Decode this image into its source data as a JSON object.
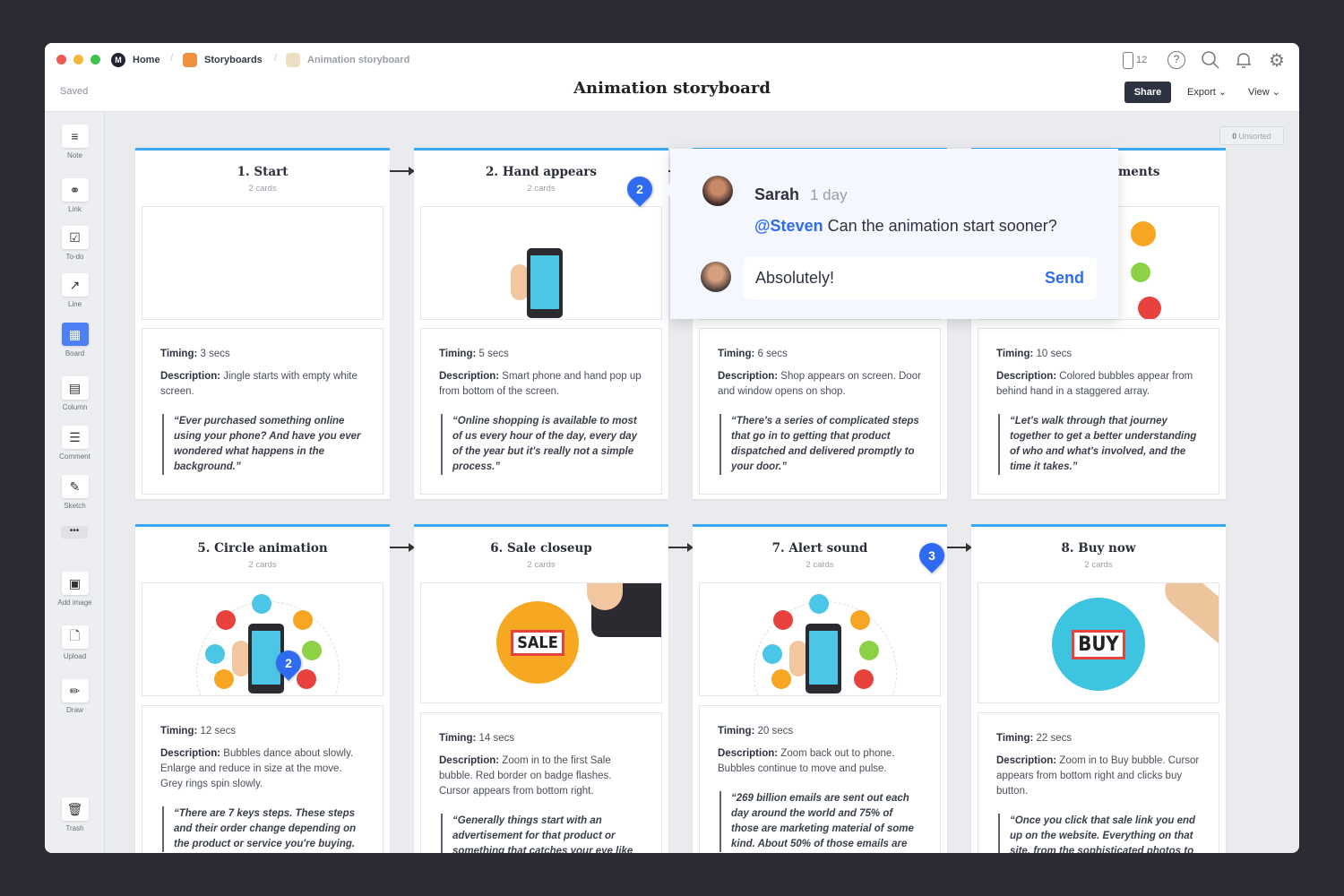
{
  "breadcrumb": {
    "home": "Home",
    "storyboards": "Storyboards",
    "current": "Animation storyboard"
  },
  "status": "Saved",
  "page_title": "Animation storyboard",
  "toolbar": {
    "device_count": "12",
    "share": "Share",
    "export": "Export",
    "view": "View"
  },
  "unsorted": {
    "count": "0",
    "label": "Unsorted"
  },
  "sidebar": {
    "items": [
      {
        "label": "Note",
        "icon": "note-icon"
      },
      {
        "label": "Link",
        "icon": "link-icon"
      },
      {
        "label": "To-do",
        "icon": "todo-icon"
      },
      {
        "label": "Line",
        "icon": "line-icon"
      },
      {
        "label": "Board",
        "icon": "board-icon"
      },
      {
        "label": "Column",
        "icon": "column-icon"
      },
      {
        "label": "Comment",
        "icon": "comment-icon"
      },
      {
        "label": "Sketch",
        "icon": "sketch-icon"
      },
      {
        "label": "Add image",
        "icon": "image-icon"
      },
      {
        "label": "Upload",
        "icon": "upload-icon"
      },
      {
        "label": "Draw",
        "icon": "draw-icon"
      },
      {
        "label": "Trash",
        "icon": "trash-icon"
      }
    ]
  },
  "labels": {
    "timing": "Timing:",
    "description": "Description:"
  },
  "cards": [
    {
      "title": "1. Start",
      "sub": "2 cards",
      "timing": "3 secs",
      "desc": "Jingle starts with empty white screen.",
      "quote": "“Ever purchased something online using your phone? And have you ever wondered what happens in the background.”",
      "art": "empty"
    },
    {
      "title": "2. Hand appears",
      "sub": "2 cards",
      "timing": "5 secs",
      "desc": "Smart phone and hand pop up from bottom of the screen.",
      "quote": "“Online shopping is available to most of us every hour of the day, every day of the year but it's really not a simple process.”",
      "art": "phone"
    },
    {
      "title": "",
      "sub": "",
      "timing": "6 secs",
      "desc": "Shop appears on screen. Door and window opens on shop.",
      "quote": "“There's  a series of complicated steps that go in to getting that product dispatched and delivered promptly to your door.”",
      "art": "shop"
    },
    {
      "title": "ments",
      "sub": "",
      "timing": "10 secs",
      "desc": "Colored bubbles appear from behind hand in a staggered array.",
      "quote": "“Let's walk through that journey together to get a better understanding of who and what's involved, and the time it takes.”",
      "art": "bubbles-partial"
    },
    {
      "title": "5. Circle animation",
      "sub": "2 cards",
      "timing": "12 secs",
      "desc": "Bubbles dance about slowly. Enlarge and reduce in size at the move. Grey rings spin slowly.",
      "quote": "“There are 7 keys steps. These steps and their order change depending on the product or service you're buying.",
      "art": "bubbles"
    },
    {
      "title": "6. Sale closeup",
      "sub": "2 cards",
      "timing": "14 secs",
      "desc": "Zoom in to the first Sale bubble. Red border on badge flashes. Cursor appears from bottom right.",
      "quote": "“Generally things start with an advertisement for that product or something that catches your eye like",
      "art": "sale",
      "badge": "SALE"
    },
    {
      "title": "7. Alert sound",
      "sub": "2 cards",
      "timing": "20 secs",
      "desc": "Zoom back out to phone. Bubbles continue to move and pulse.",
      "quote": "“269 billion emails are sent out each day around the world and 75% of those are marketing material of some kind. About 50% of those emails are",
      "art": "bubbles"
    },
    {
      "title": "8. Buy now",
      "sub": "2 cards",
      "timing": "22 secs",
      "desc": "Zoom in to Buy bubble. Cursor appears from bottom right and clicks buy button.",
      "quote": "“Once you click that sale link you end up on the website. Everything on that site, from the sophisticated photos to",
      "art": "buy",
      "badge": "BUY"
    }
  ],
  "pins": [
    "2",
    "3",
    "2"
  ],
  "comment": {
    "author": "Sarah",
    "time": "1 day",
    "mention": "@Steven",
    "text": "Can the animation start sooner?",
    "reply_value": "Absolutely!",
    "send": "Send"
  },
  "colors": {
    "accent": "#3aa9f2",
    "pin": "#2f6bf0",
    "share_bg": "#2d3340"
  }
}
